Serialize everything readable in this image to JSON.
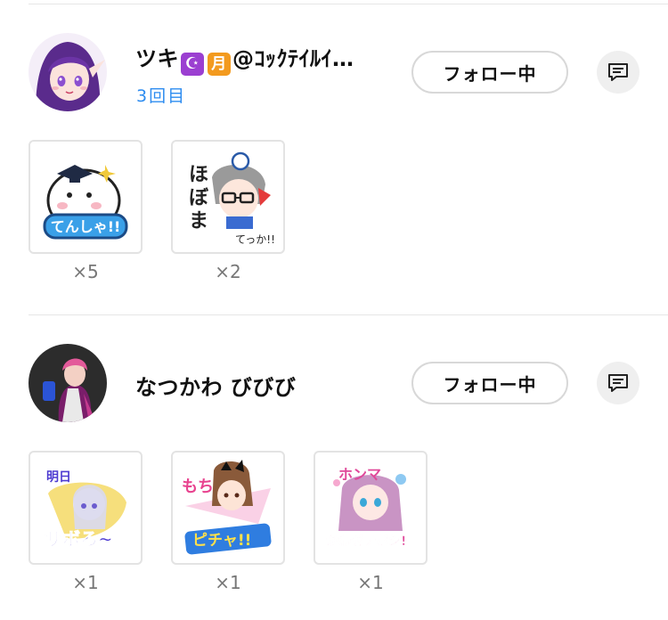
{
  "follow_list": [
    {
      "name_prefix": "ツキ",
      "name_emoji_1": "☪",
      "name_emoji_2": "月",
      "name_suffix": "@ｺｯｸﾃｲﾙｲ…",
      "visits": "3回目",
      "follow_label": "フォロー中",
      "stickers": [
        {
          "icon": "tenshaa-sticker-icon",
          "count": "×5"
        },
        {
          "icon": "glasses-character-sticker-icon",
          "count": "×2"
        }
      ]
    },
    {
      "name": "なつかわ びびび",
      "follow_label": "フォロー中",
      "stickers": [
        {
          "icon": "ashita-sabo-sticker-icon",
          "count": "×1"
        },
        {
          "icon": "mochi-sticker-icon",
          "count": "×1"
        },
        {
          "icon": "honma-sticker-icon",
          "count": "×1"
        }
      ]
    }
  ],
  "colors": {
    "accent_blue": "#2d8cf0",
    "emoji_purple": "#9b3fd1",
    "emoji_orange": "#f39a1e"
  }
}
